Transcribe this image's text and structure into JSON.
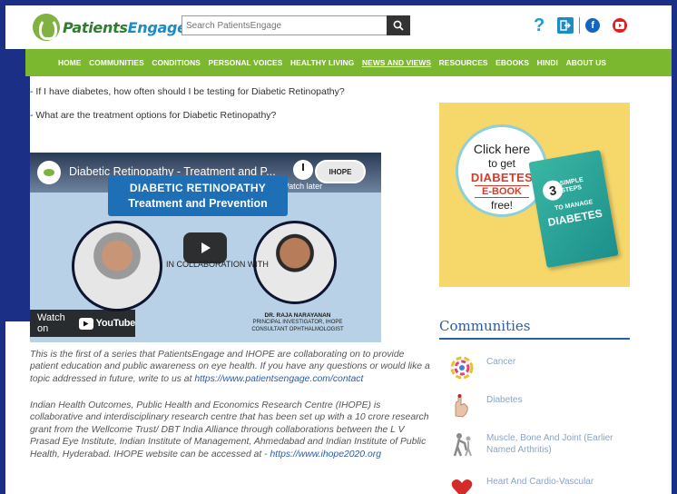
{
  "site": {
    "logo_main": "Patients",
    "logo_accent": "Engage"
  },
  "search": {
    "placeholder": "Search PatientsEngage"
  },
  "header_icons": [
    "help-icon",
    "login-icon",
    "facebook-icon",
    "youtube-icon"
  ],
  "nav": {
    "items": [
      "HOME",
      "COMMUNITIES",
      "CONDITIONS",
      "PERSONAL VOICES",
      "HEALTHY LIVING",
      "NEWS AND VIEWS",
      "RESOURCES",
      "EBOOKS",
      "HINDI",
      "ABOUT US"
    ],
    "active_index": 5
  },
  "content": {
    "question1": "- If I have diabetes, how often should I be testing for Diabetic Retinopathy?",
    "question2": "- What are the treatment options for Diabetic Retinopathy?",
    "video": {
      "title": "Diabetic Retinopathy - Treatment and P...",
      "watch_later": "Watch later",
      "badge": "IHOPE",
      "banner_line1": "DIABETIC RETINOPATHY",
      "banner_line2": "Treatment and Prevention",
      "in_collab": "IN COLLABORATION WITH",
      "doctor_name": "DR. RAJA NARAYANAN",
      "doctor_role1": "PRINCIPAL INVESTIGATOR, IHOPE",
      "doctor_role2": "CONSULTANT OPHTHALMOLOGIST",
      "watch_on": "Watch on",
      "youtube": "YouTube"
    },
    "para1_text": "This is the first of a series that PatientsEngage and IHOPE are collaborating on to provide patient education and public awareness on eye health.  If you have any questions or would like a topic addressed in future, write to us at ",
    "para1_link": "https://www.patientsengage.com/contact",
    "para2_text": "Indian Health Outcomes, Public Health and Economics Research Centre (IHOPE) is collaborative and interdisciplinary research centre that has been set up with a 10 crore research grant from the Wellcome Trust/ DBT India Alliance through collaborations between the L V Prasad Eye Institute, Indian Institute of Management, Ahmedabad and Indian Institute of Public Health, Hyderabad.  IHOPE website can be accessed at - ",
    "para2_link": "https://www.ihope2020.org"
  },
  "promo": {
    "line1": "Click here",
    "line2": "to get",
    "line3": "DIABETES",
    "line4": "E-BOOK",
    "line5": "free!",
    "book_number": "3",
    "book_line1": "SIMPLE STEPS",
    "book_line2": "TO MANAGE",
    "book_line3": "DIABETES"
  },
  "communities": {
    "title": "Communities",
    "items": [
      {
        "label": "Cancer",
        "icon": "cancer-ribbon-icon"
      },
      {
        "label": "Diabetes",
        "icon": "glucose-test-icon"
      },
      {
        "label": "Muscle, Bone And Joint (Earlier Named Arthritis)",
        "icon": "joint-pain-icon"
      },
      {
        "label": "Heart And Cardio-Vascular",
        "icon": "heart-icon"
      }
    ]
  }
}
